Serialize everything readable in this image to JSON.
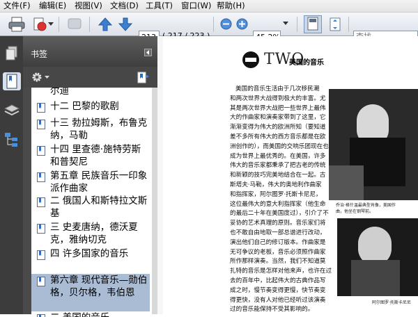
{
  "menu": [
    "文件(F)",
    "编辑(E)",
    "视图(V)",
    "文档(D)",
    "工具(T)",
    "窗口(W)",
    "帮助(H)"
  ],
  "toolbar": {
    "page_number": "213",
    "page_label": "( 217 / 223 )",
    "zoom": "45.2%",
    "search_placeholder": "查找"
  },
  "sidebar": {
    "title": "书签",
    "bookmarks": [
      {
        "label": "尔迪",
        "selected": false
      },
      {
        "label": "十二 巴黎的歌剧",
        "selected": false
      },
      {
        "label": "十三 勃拉姆斯，布鲁克纳，马勒",
        "selected": false
      },
      {
        "label": "十四 里查德·施特劳斯和普契尼",
        "selected": false
      },
      {
        "label": "第五章 民族音乐一印象派作曲家",
        "selected": false
      },
      {
        "label": "二 俄国人和斯特拉文斯基",
        "selected": false
      },
      {
        "label": "三 史麦唐纳，德沃夏克，雅纳切克",
        "selected": false
      },
      {
        "label": "四 许多国家的音乐",
        "selected": false
      },
      {
        "label": "第六章 现代音乐—勋伯格，贝尔格，韦伯恩",
        "selected": true
      },
      {
        "label": "二 美国的音乐",
        "selected": false
      }
    ]
  },
  "document": {
    "heading_prefix": "TWO",
    "heading": "美国的音乐",
    "lines": [
      "美国的音乐生活由于几次移民潮",
      "和两次世界大战得到极大的丰富。尤",
      "其是两次世界大战把一些世界上最伟",
      "大的作曲家和演奏家带到了这里，它",
      "渐渐变得为伟大的欧洲所知（要知道",
      "差不多所有伟大的西方音乐都是在欧",
      "洲创作的），而美国的交响乐团现在也",
      "成为世界上最优秀的。在美国，许多",
      "伟大的音乐家都秉承了把古老的传统",
      "和新颖的技巧完美地结合在一起。古",
      "斯塔夫·马勒，伟大的奥地利作曲家",
      "和指挥家，阿尔图罗·托斯卡尼尼，",
      "这位最伟大的意大利指挥家（他生命",
      "的最后二十年在美国度过），引介了不",
      "妥协的艺术真理的原则。音乐家们将",
      "也不敢自由地取一部总谱进行改动，",
      "演出他们自己的修订版本。作曲家是",
      "无可争议的老板，音乐必须照作曲家",
      "所作那样演奏。当然，我们不知道莫",
      "扎特的音乐是怎样对他来声，也许在过",
      "去的百年中，比起伟大的古典作品写",
      "成之时，慢节奏变得更慢，快节奏变",
      "得更快，没有人对他已经听过该演奏",
      "过的音乐能保持不受其影响的。"
    ],
    "caption1": "乔治·格什温最典型肖像，美国作",
    "caption1b": "曲，他坐在钢琴前。",
    "caption2": "阿尔图罗·托斯卡尼尼"
  },
  "colors": {
    "accent": "#aabbd4",
    "panel": "#4a4a4a",
    "toolbar": "#dde2e9"
  }
}
